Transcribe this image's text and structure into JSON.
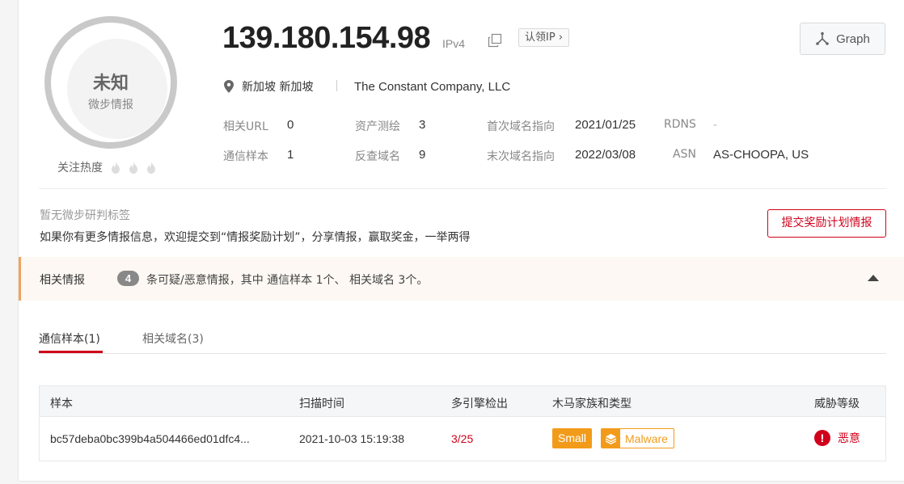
{
  "verdict": {
    "title": "未知",
    "subtitle": "微步情报",
    "heat_label": "关注热度"
  },
  "ip": {
    "address": "139.180.154.98",
    "version": "IPv4",
    "claim_label": "认领IP",
    "claim_chevron": "›"
  },
  "graph_button": {
    "label": "Graph"
  },
  "location": {
    "text": "新加坡 新加坡",
    "org": "The Constant Company, LLC"
  },
  "stats": {
    "related_url": {
      "label": "相关URL",
      "value": "0"
    },
    "asset_map": {
      "label": "资产测绘",
      "value": "3"
    },
    "first_domain": {
      "label": "首次域名指向",
      "value": "2021/01/25"
    },
    "rdns": {
      "label": "RDNS",
      "value": "-"
    },
    "comm_samples": {
      "label": "通信样本",
      "value": "1"
    },
    "reverse_domains": {
      "label": "反查域名",
      "value": "9"
    },
    "last_domain": {
      "label": "末次域名指向",
      "value": "2022/03/08"
    },
    "asn": {
      "label": "ASN",
      "value": "AS-CHOOPA, US"
    }
  },
  "tags": {
    "none_text": "暂无微步研判标签",
    "invite_text": "如果你有更多情报信息，欢迎提交到“情报奖励计划”，分享情报，赢取奖金，一举两得",
    "submit_label": "提交奖励计划情报"
  },
  "related": {
    "title": "相关情报",
    "count": "4",
    "description": "条可疑/恶意情报，其中 通信样本 1个、 相关域名 3个。"
  },
  "tabs": [
    {
      "label": "通信样本(1)",
      "active": true
    },
    {
      "label": "相关域名(3)",
      "active": false
    }
  ],
  "table": {
    "headers": [
      "样本",
      "扫描时间",
      "多引擎检出",
      "木马家族和类型",
      "威胁等级"
    ],
    "rows": [
      {
        "sample": "bc57deba0bc399b4a504466ed01dfc4...",
        "scan_time": "2021-10-03 15:19:38",
        "detection": "3/25",
        "family": "Small",
        "type": "Malware",
        "threat": "恶意",
        "threat_mark": "!"
      }
    ]
  },
  "colors": {
    "accent_red": "#d0021b",
    "tag_orange": "#f29b1b",
    "gauge_gray": "#c9c9c9"
  },
  "icons": [
    "copy-icon",
    "graph-icon",
    "location-pin-icon",
    "flame-icon",
    "caret-up-icon",
    "layers-icon",
    "alert-icon"
  ]
}
